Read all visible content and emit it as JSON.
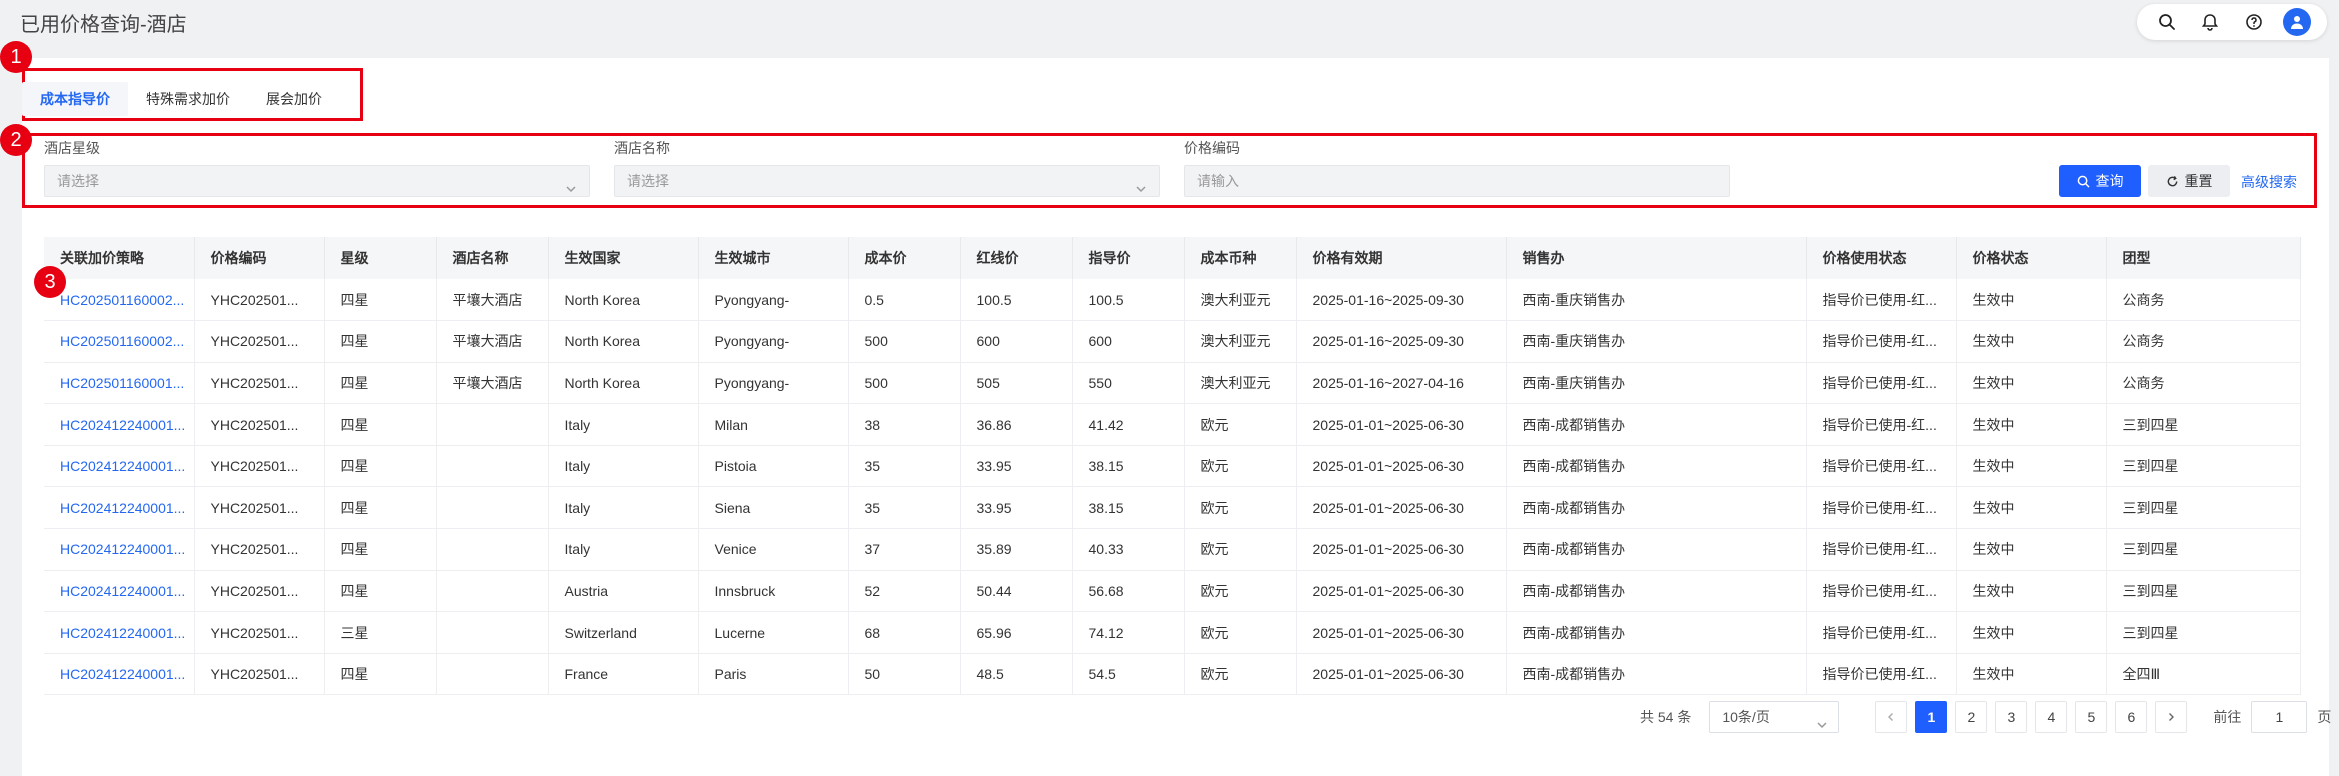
{
  "header": {
    "title": "已用价格查询-酒店",
    "icons": [
      "search-icon",
      "bell-icon",
      "help-icon",
      "user-icon"
    ]
  },
  "markers": [
    "1",
    "2",
    "3"
  ],
  "tabs": [
    {
      "label": "成本指导价",
      "active": true
    },
    {
      "label": "特殊需求加价",
      "active": false
    },
    {
      "label": "展会加价",
      "active": false
    }
  ],
  "filters": {
    "hotel_star": {
      "label": "酒店星级",
      "placeholder": "请选择"
    },
    "hotel_name": {
      "label": "酒店名称",
      "placeholder": "请选择"
    },
    "price_code": {
      "label": "价格编码",
      "placeholder": "请输入"
    },
    "query_label": "查询",
    "reset_label": "重置",
    "advanced_label": "高级搜索"
  },
  "table": {
    "columns": [
      "关联加价策略",
      "价格编码",
      "星级",
      "酒店名称",
      "生效国家",
      "生效城市",
      "成本价",
      "红线价",
      "指导价",
      "成本币种",
      "价格有效期",
      "销售办",
      "价格使用状态",
      "价格状态",
      "团型"
    ],
    "rows": [
      [
        "HC202501160002...",
        "YHC202501...",
        "四星",
        "平壤大酒店",
        "North Korea",
        "Pyongyang-",
        "0.5",
        "100.5",
        "100.5",
        "澳大利亚元",
        "2025-01-16~2025-09-30",
        "西南-重庆销售办",
        "指导价已使用-红...",
        "生效中",
        "公商务"
      ],
      [
        "HC202501160002...",
        "YHC202501...",
        "四星",
        "平壤大酒店",
        "North Korea",
        "Pyongyang-",
        "500",
        "600",
        "600",
        "澳大利亚元",
        "2025-01-16~2025-09-30",
        "西南-重庆销售办",
        "指导价已使用-红...",
        "生效中",
        "公商务"
      ],
      [
        "HC202501160001...",
        "YHC202501...",
        "四星",
        "平壤大酒店",
        "North Korea",
        "Pyongyang-",
        "500",
        "505",
        "550",
        "澳大利亚元",
        "2025-01-16~2027-04-16",
        "西南-重庆销售办",
        "指导价已使用-红...",
        "生效中",
        "公商务"
      ],
      [
        "HC202412240001...",
        "YHC202501...",
        "四星",
        "",
        "Italy",
        "Milan",
        "38",
        "36.86",
        "41.42",
        "欧元",
        "2025-01-01~2025-06-30",
        "西南-成都销售办",
        "指导价已使用-红...",
        "生效中",
        "三到四星"
      ],
      [
        "HC202412240001...",
        "YHC202501...",
        "四星",
        "",
        "Italy",
        "Pistoia",
        "35",
        "33.95",
        "38.15",
        "欧元",
        "2025-01-01~2025-06-30",
        "西南-成都销售办",
        "指导价已使用-红...",
        "生效中",
        "三到四星"
      ],
      [
        "HC202412240001...",
        "YHC202501...",
        "四星",
        "",
        "Italy",
        "Siena",
        "35",
        "33.95",
        "38.15",
        "欧元",
        "2025-01-01~2025-06-30",
        "西南-成都销售办",
        "指导价已使用-红...",
        "生效中",
        "三到四星"
      ],
      [
        "HC202412240001...",
        "YHC202501...",
        "四星",
        "",
        "Italy",
        "Venice",
        "37",
        "35.89",
        "40.33",
        "欧元",
        "2025-01-01~2025-06-30",
        "西南-成都销售办",
        "指导价已使用-红...",
        "生效中",
        "三到四星"
      ],
      [
        "HC202412240001...",
        "YHC202501...",
        "四星",
        "",
        "Austria",
        "Innsbruck",
        "52",
        "50.44",
        "56.68",
        "欧元",
        "2025-01-01~2025-06-30",
        "西南-成都销售办",
        "指导价已使用-红...",
        "生效中",
        "三到四星"
      ],
      [
        "HC202412240001...",
        "YHC202501...",
        "三星",
        "",
        "Switzerland",
        "Lucerne",
        "68",
        "65.96",
        "74.12",
        "欧元",
        "2025-01-01~2025-06-30",
        "西南-成都销售办",
        "指导价已使用-红...",
        "生效中",
        "三到四星"
      ],
      [
        "HC202412240001...",
        "YHC202501...",
        "四星",
        "",
        "France",
        "Paris",
        "50",
        "48.5",
        "54.5",
        "欧元",
        "2025-01-01~2025-06-30",
        "西南-成都销售办",
        "指导价已使用-红...",
        "生效中",
        "全四Ⅲ"
      ]
    ]
  },
  "pagination": {
    "total_text": "共 54 条",
    "page_size": "10条/页",
    "pages": [
      "1",
      "2",
      "3",
      "4",
      "5",
      "6"
    ],
    "current_page": "1",
    "goto_label": "前往",
    "goto_value": "1",
    "page_suffix": "页"
  },
  "colors": {
    "primary": "#1f5eff",
    "link": "#2468f2",
    "highlight": "#e60012"
  }
}
